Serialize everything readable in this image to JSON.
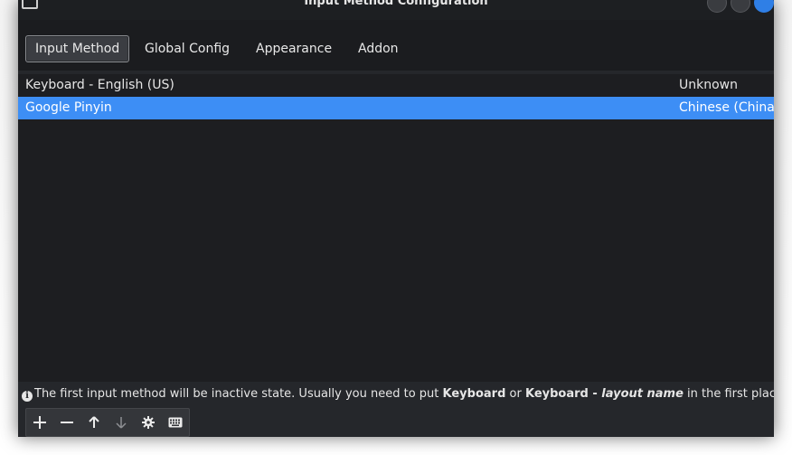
{
  "window": {
    "title": "Input Method Configuration"
  },
  "tabs": [
    {
      "label": "Input Method",
      "active": true
    },
    {
      "label": "Global Config",
      "active": false
    },
    {
      "label": "Appearance",
      "active": false
    },
    {
      "label": "Addon",
      "active": false
    }
  ],
  "input_methods": [
    {
      "name": "Keyboard - English (US)",
      "language": "Unknown",
      "selected": false
    },
    {
      "name": "Google Pinyin",
      "language": "Chinese (China)",
      "selected": true
    }
  ],
  "info": {
    "icon": "info-icon",
    "text_1": "The first input method will be inactive state. Usually you need to put ",
    "bold_1": "Keyboard",
    "text_2": " or ",
    "bold_2": "Keyboard - ",
    "italic_1": "layout name",
    "text_3": " in the first place."
  },
  "toolbar": {
    "add_icon": "plus-icon",
    "remove_icon": "minus-icon",
    "up_icon": "arrow-up-icon",
    "down_icon": "arrow-down-icon",
    "configure_icon": "gear-icon",
    "keyboard_icon": "keyboard-icon"
  },
  "colors": {
    "selection": "#3d8ef5",
    "window_bg": "#25272b",
    "list_bg": "#1d1e21"
  }
}
